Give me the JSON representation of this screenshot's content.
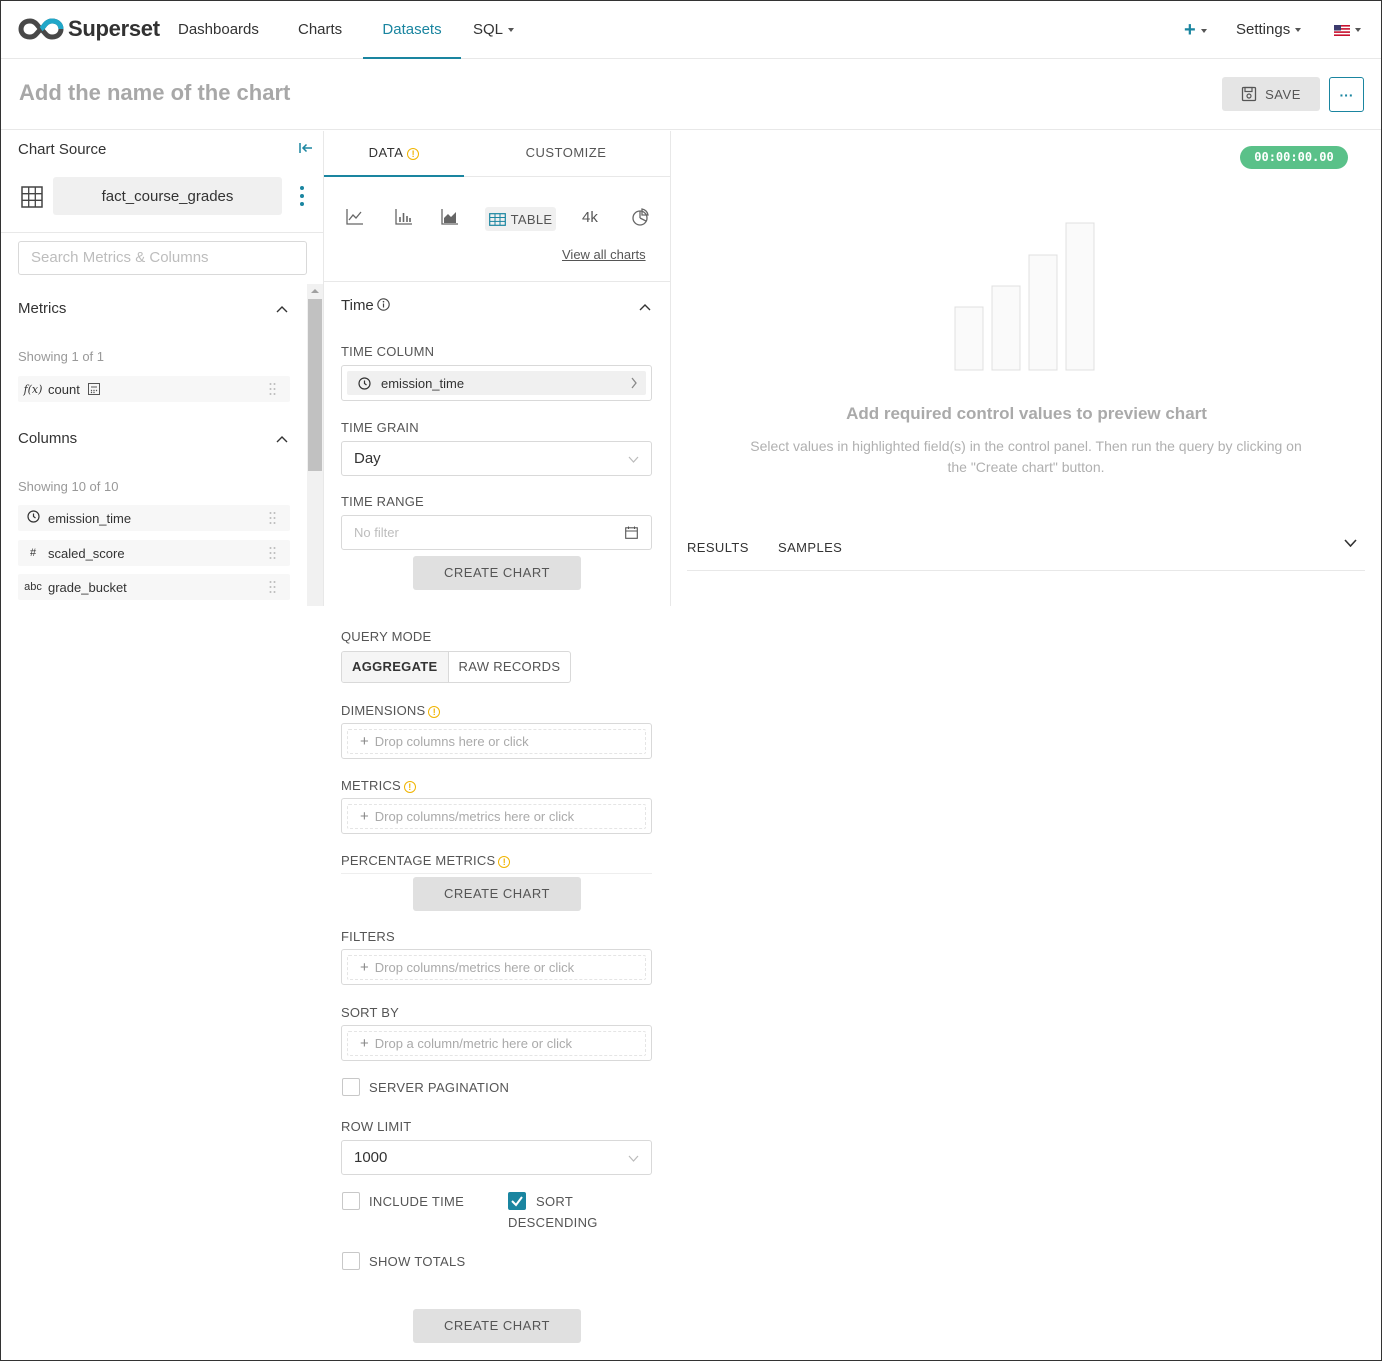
{
  "brand": {
    "name": "Superset"
  },
  "nav": {
    "items": [
      {
        "label": "Dashboards"
      },
      {
        "label": "Charts"
      },
      {
        "label": "Datasets"
      },
      {
        "label": "SQL"
      }
    ],
    "active": "Datasets",
    "settings_label": "Settings"
  },
  "header": {
    "title_placeholder": "Add the name of the chart",
    "save_label": "SAVE",
    "more_label": "···"
  },
  "datasource": {
    "panel_title": "Chart Source",
    "name": "fact_course_grades",
    "search_placeholder": "Search Metrics & Columns",
    "metrics_title": "Metrics",
    "metrics_showing": "Showing 1 of 1",
    "metrics": [
      {
        "type": "f(x)",
        "name": "count"
      }
    ],
    "columns_title": "Columns",
    "columns_showing": "Showing 10 of 10",
    "columns": [
      {
        "type": "clock",
        "name": "emission_time"
      },
      {
        "type": "#",
        "name": "scaled_score"
      },
      {
        "type": "abc",
        "name": "grade_bucket"
      }
    ]
  },
  "control_panel": {
    "tabs": {
      "data": "DATA",
      "customize": "CUSTOMIZE"
    },
    "viz": {
      "table_label": "TABLE",
      "bignum_label": "4k",
      "view_all": "View all charts"
    },
    "time": {
      "title": "Time",
      "time_column_label": "TIME COLUMN",
      "time_column_value": "emission_time",
      "time_grain_label": "TIME GRAIN",
      "time_grain_value": "Day",
      "time_range_label": "TIME RANGE",
      "time_range_value": "No filter"
    },
    "create_chart_label": "CREATE CHART",
    "query": {
      "mode_label": "QUERY MODE",
      "mode_aggregate": "AGGREGATE",
      "mode_raw": "RAW RECORDS",
      "dimensions_label": "DIMENSIONS",
      "dimensions_placeholder": "Drop columns here or click",
      "metrics_label": "METRICS",
      "metrics_placeholder": "Drop columns/metrics here or click",
      "percentage_label": "PERCENTAGE METRICS",
      "filters_label": "FILTERS",
      "filters_placeholder": "Drop columns/metrics here or click",
      "sortby_label": "SORT BY",
      "sortby_placeholder": "Drop a column/metric here or click",
      "server_pagination_label": "SERVER PAGINATION",
      "server_pagination_checked": false,
      "row_limit_label": "ROW LIMIT",
      "row_limit_value": "1000",
      "include_time_label": "INCLUDE TIME",
      "include_time_checked": false,
      "sort_desc_label_1": "SORT",
      "sort_desc_label_2": "DESCENDING",
      "sort_desc_checked": true,
      "show_totals_label": "SHOW TOTALS",
      "show_totals_checked": false
    }
  },
  "preview": {
    "timer": "00:00:00.00",
    "empty_title": "Add required control values to preview chart",
    "empty_desc": "Select values in highlighted field(s) in the control panel. Then run the query by clicking on the \"Create chart\" button.",
    "tabs": {
      "results": "RESULTS",
      "samples": "SAMPLES"
    }
  },
  "colors": {
    "accent": "#1a85a0",
    "warning": "#f0b400",
    "timer_bg": "#5ac189"
  }
}
